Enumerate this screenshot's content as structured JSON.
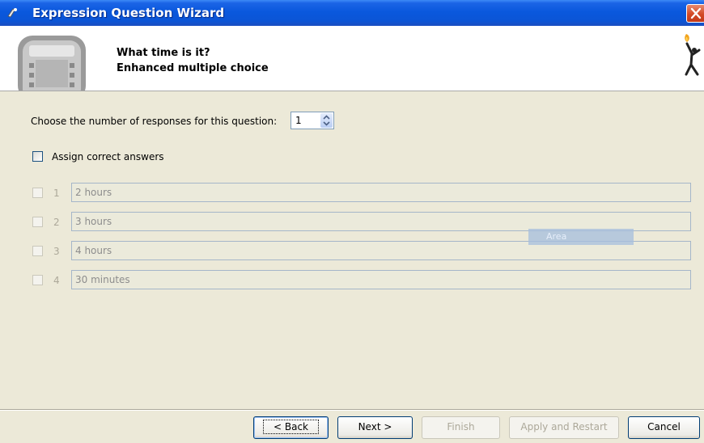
{
  "window": {
    "title": "Expression Question Wizard"
  },
  "header": {
    "title": "What time is it?",
    "subtitle": "Enhanced multiple choice"
  },
  "responses_count": {
    "label": "Choose the number of responses for this question:",
    "value": "1"
  },
  "assign_correct": {
    "label": "Assign correct answers",
    "checked": false
  },
  "responses": [
    {
      "number": "1",
      "text": "2 hours"
    },
    {
      "number": "2",
      "text": "3 hours"
    },
    {
      "number": "3",
      "text": "4 hours"
    },
    {
      "number": "4",
      "text": "30 minutes"
    }
  ],
  "overlay": {
    "area_label": "Area"
  },
  "buttons": {
    "back": "< Back",
    "next": "Next >",
    "finish": "Finish",
    "apply_restart": "Apply and Restart",
    "cancel": "Cancel"
  },
  "colors": {
    "titlebar": "#0a58dd",
    "body": "#ece9d8",
    "header": "#ffffff"
  }
}
